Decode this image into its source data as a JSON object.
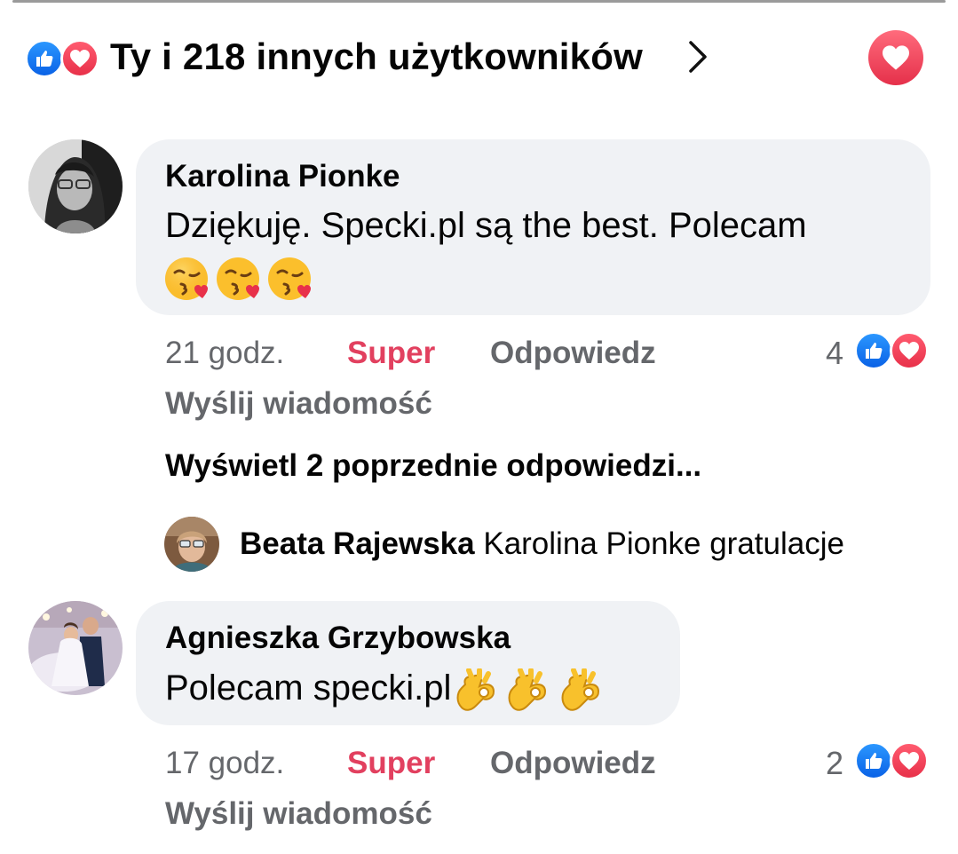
{
  "header": {
    "title": "Ty i 218 innych użytkowników",
    "reaction_icons": [
      "like-icon",
      "love-icon"
    ],
    "chevron_icon": "chevron-right-icon",
    "love_button_icon": "heart-icon"
  },
  "colors": {
    "like_blue": "#1877f2",
    "love_red": "#f0354f",
    "super_red": "#e2405f",
    "bubble_bg": "#f0f2f5",
    "meta_gray": "#65676b"
  },
  "comments": [
    {
      "author": "Karolina Pionke",
      "text": "Dziękuję. Specki.pl są the best. Polecam",
      "emoji": [
        "face-blowing-kiss",
        "face-blowing-kiss",
        "face-blowing-kiss"
      ],
      "time": "21 godz.",
      "reaction_label": "Super",
      "reply_label": "Odpowiedz",
      "message_label": "Wyślij wiadomość",
      "reaction_count": "4"
    },
    {
      "author": "Agnieszka Grzybowska",
      "text": "Polecam specki.pl",
      "emoji": [
        "ok-hand",
        "ok-hand",
        "ok-hand"
      ],
      "time": "17 godz.",
      "reaction_label": "Super",
      "reply_label": "Odpowiedz",
      "message_label": "Wyślij wiadomość",
      "reaction_count": "2"
    }
  ],
  "view_previous": "Wyświetl 2 poprzednie odpowiedzi...",
  "reply": {
    "author": "Beata Rajewska",
    "text": "Karolina Pionke gratulacje"
  }
}
